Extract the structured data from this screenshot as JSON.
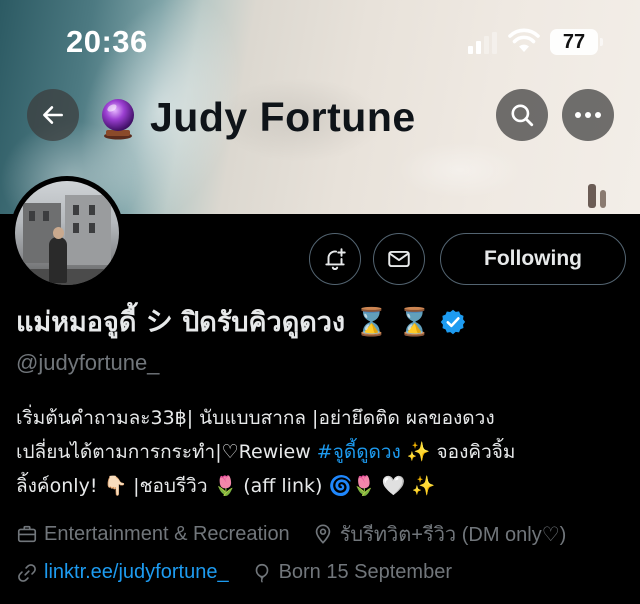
{
  "status_bar": {
    "time": "20:36",
    "battery": "77"
  },
  "header": {
    "title": "Judy Fortune",
    "title_emoji": "crystal-ball-icon"
  },
  "actions": {
    "following_label": "Following"
  },
  "profile": {
    "display_name": "แม่หมอจูดี้ シ ปิดรับคิวดูดวง ⌛️ ⌛️",
    "handle": "@judyfortune_",
    "verified": true,
    "bio": {
      "line1": "เริ่มต้นคำถามละ33฿| นับแบบสากล |อย่ายึดติด ผลของดวง",
      "line2_prefix": "เปลี่ยนได้ตามการกระทำ|♡Rewiew ",
      "line2_hashtag": "#จูดี้ดูดวง",
      "line2_suffix": " ✨ จองคิวจิ้ม",
      "line3": "ลิ้งค์only! 👇🏻 |ชอบรีวิว 🌷 (aff link) 🌀🌷 🤍 ✨"
    },
    "category": "Entertainment & Recreation",
    "location": "รับรีทวิต+รีวิว (DM only♡)",
    "website": "linktr.ee/judyfortune_",
    "birthday": "Born 15 September"
  },
  "colors": {
    "background": "#000000",
    "text_primary": "#e7e9ea",
    "text_secondary": "#71767b",
    "accent_blue": "#1d9bf0",
    "border": "#536471"
  }
}
